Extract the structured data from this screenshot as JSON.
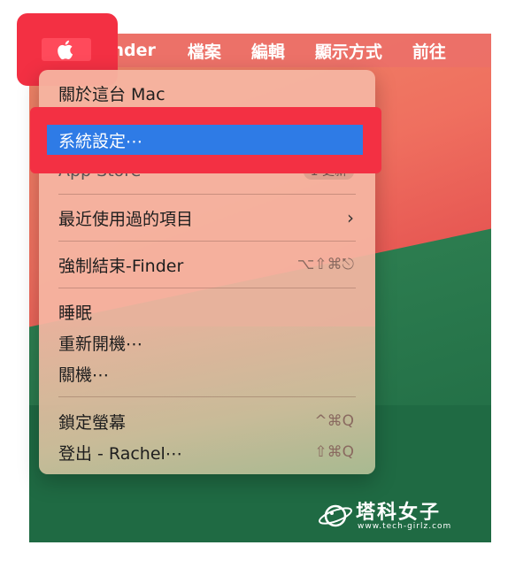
{
  "menubar": {
    "app_name": "Finder",
    "items": [
      "檔案",
      "編輯",
      "顯示方式",
      "前往"
    ]
  },
  "apple_menu": {
    "items": [
      {
        "label": "關於這台 Mac",
        "shortcut": ""
      },
      {
        "label": "系統設定⋯",
        "shortcut": ""
      },
      {
        "label": "App Store",
        "shortcut": "1 更新"
      },
      {
        "label": "最近使用過的項目",
        "shortcut": ""
      },
      {
        "label": "強制結束-Finder",
        "shortcut": "⌥⇧⌘⎋"
      },
      {
        "label": "睡眠",
        "shortcut": ""
      },
      {
        "label": "重新開機⋯",
        "shortcut": ""
      },
      {
        "label": "關機⋯",
        "shortcut": ""
      },
      {
        "label": "鎖定螢幕",
        "shortcut": "^⌘Q"
      },
      {
        "label": "登出 - Rachel⋯",
        "shortcut": "⇧⌘Q"
      }
    ]
  },
  "watermark": {
    "title": "塔科女子",
    "url": "www.tech-girlz.com"
  },
  "colors": {
    "highlight_red": "#f33043",
    "selection_blue": "#2e7be6"
  }
}
